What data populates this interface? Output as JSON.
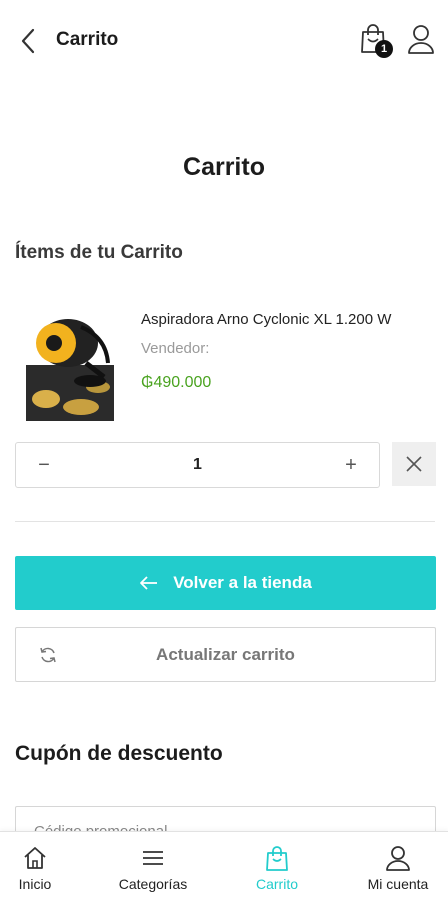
{
  "header": {
    "title": "Carrito",
    "cart_count": "1"
  },
  "page": {
    "title": "Carrito",
    "items_heading": "Ítems de tu Carrito"
  },
  "cart_item": {
    "name": "Aspiradora Arno Cyclonic XL 1.200 W",
    "seller_label": "Vendedor:",
    "price": "₲490.000",
    "quantity": "1",
    "minus": "−",
    "plus": "+"
  },
  "actions": {
    "back_to_store": "Volver a la tienda",
    "update_cart": "Actualizar carrito"
  },
  "coupon": {
    "heading": "Cupón de descuento",
    "placeholder": "Código promocional"
  },
  "bottom_nav": {
    "items": [
      {
        "label": "Inicio",
        "icon": "home-icon"
      },
      {
        "label": "Categorías",
        "icon": "menu-icon"
      },
      {
        "label": "Carrito",
        "icon": "shopping-bag-icon"
      },
      {
        "label": "Mi cuenta",
        "icon": "user-icon"
      }
    ],
    "active": "Carrito"
  },
  "colors": {
    "accent": "#22cccc",
    "price": "#4aa320"
  }
}
